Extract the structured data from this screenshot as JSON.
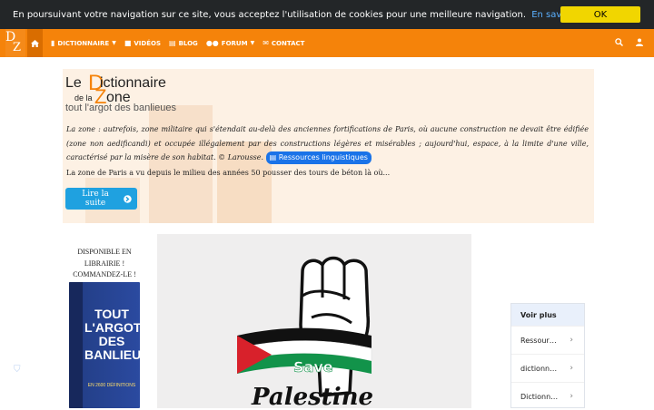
{
  "cookie": {
    "message": "En poursuivant votre navigation sur ce site, vous acceptez l'utilisation de cookies pour une meilleure navigation.",
    "link": "En savoir plus.",
    "ok": "OK"
  },
  "nav": {
    "items": [
      {
        "label": "DICTIONNAIRE",
        "icon": "book-icon",
        "dropdown": true
      },
      {
        "label": "VIDÉOS",
        "icon": "video-icon",
        "dropdown": false
      },
      {
        "label": "BLOG",
        "icon": "newspaper-icon",
        "dropdown": false
      },
      {
        "label": "FORUM",
        "icon": "users-icon",
        "dropdown": true
      },
      {
        "label": "CONTACT",
        "icon": "envelope-icon",
        "dropdown": false
      }
    ]
  },
  "brand": {
    "le": "Le",
    "d": "D",
    "ictionnaire": "ictionnaire",
    "dela": "de la",
    "z": "Z",
    "one": "one",
    "tagline": "tout l'argot des banlieues"
  },
  "hero": {
    "definition": "La zone : autrefois, zone militaire qui s'étendait au-delà des anciennes fortifications de Paris, où aucune construction ne devait être édifiée (zone non aedificandi) et occupée illégalement par des constructions légères et misérables ; aujourd'hui, espace, à la limite d'une ville, caractérisé par la misère de son habitat. © Larousse.",
    "resources": "Ressources linguistiques",
    "summary": "La zone de Paris a vu depuis le milieu des années 50 pousser des tours de béton là où...",
    "read_more": "Lire la suite"
  },
  "book": {
    "caption": "DISPONIBLE EN LIBRAIRIE ! COMMANDEZ-LE !",
    "title_lines": [
      "TOUT",
      "L'ARGOT",
      "DES",
      "BANLIEUES"
    ],
    "subtitle": "EN 2600 DÉFINITIONS"
  },
  "banner": {
    "save": "Save",
    "palestine": "Palestine"
  },
  "sidebar": {
    "heading": "Voir plus",
    "items": [
      "Ressour…",
      "dictionn…",
      "Dictionn…"
    ]
  },
  "colors": {
    "accent": "#f5830a",
    "link": "#5bb0ff",
    "button": "#1fa1e0"
  }
}
